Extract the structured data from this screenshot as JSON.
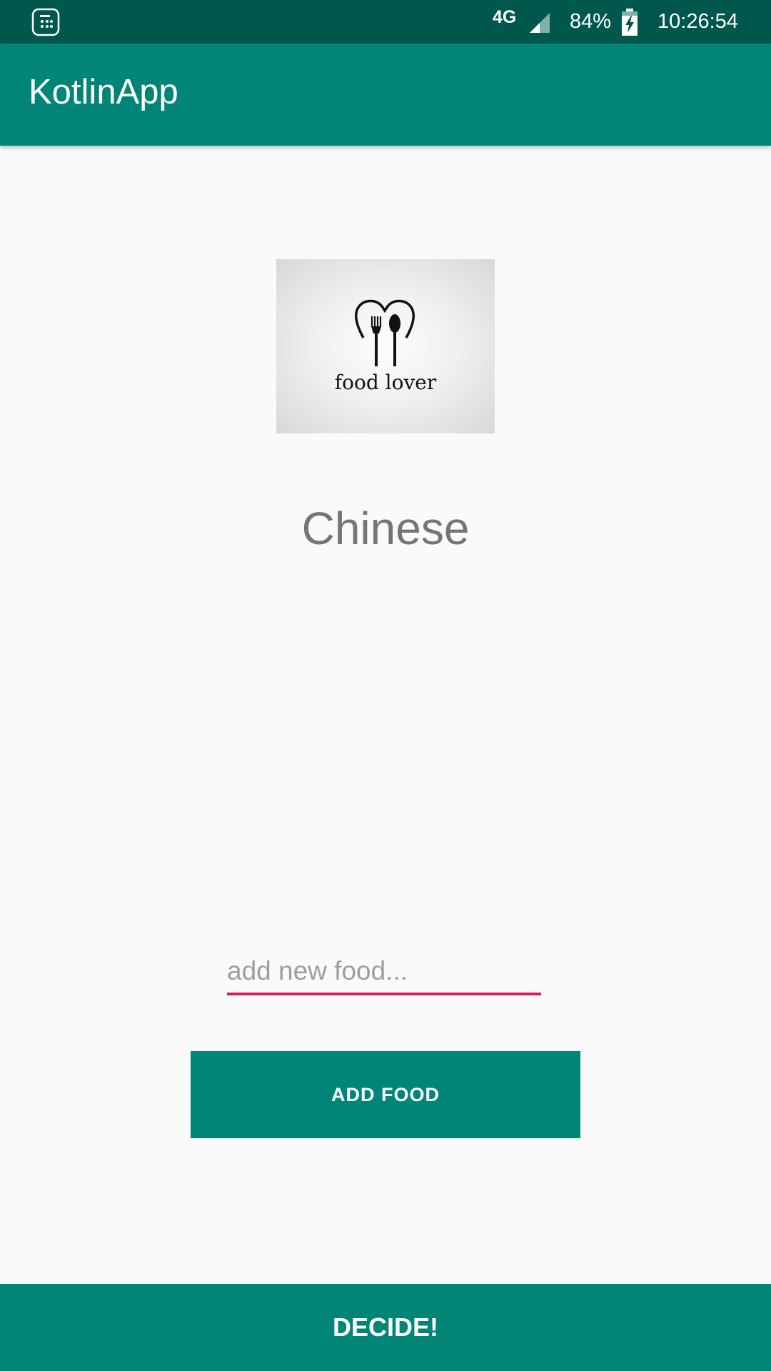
{
  "status_bar": {
    "network_type": "4G",
    "battery_percent": "84%",
    "time": "10:26:54",
    "icons": [
      "app-notification-icon",
      "signal-icon",
      "battery-charging-icon"
    ]
  },
  "app_bar": {
    "title": "KotlinApp"
  },
  "food_image": {
    "logo_text": "food lover",
    "icon": "heart-fork-spoon-logo"
  },
  "selected_food": "Chinese",
  "food_input": {
    "value": "",
    "placeholder": "add new food..."
  },
  "add_food_button": {
    "label": "ADD FOOD"
  },
  "decide_button": {
    "label": "DECIDE!"
  },
  "colors": {
    "status_bar": "#00574b",
    "primary": "#008577",
    "accent": "#d81b60",
    "background": "#fafafa",
    "selected_text": "#757575"
  }
}
